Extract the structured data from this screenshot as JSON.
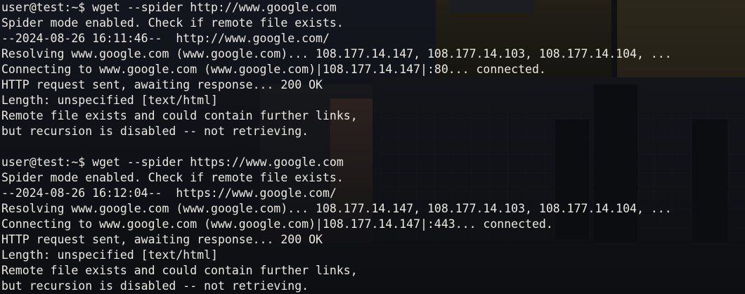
{
  "terminal": {
    "blocks": [
      {
        "prompt": "user@test:~$",
        "command": "wget --spider http://www.google.com",
        "output": [
          "Spider mode enabled. Check if remote file exists.",
          "--2024-08-26 16:11:46--  http://www.google.com/",
          "Resolving www.google.com (www.google.com)... 108.177.14.147, 108.177.14.103, 108.177.14.104, ...",
          "Connecting to www.google.com (www.google.com)|108.177.14.147|:80... connected.",
          "HTTP request sent, awaiting response... 200 OK",
          "Length: unspecified [text/html]",
          "Remote file exists and could contain further links,",
          "but recursion is disabled -- not retrieving."
        ]
      },
      {
        "prompt": "user@test:~$",
        "command": "wget --spider https://www.google.com",
        "output": [
          "Spider mode enabled. Check if remote file exists.",
          "--2024-08-26 16:12:04--  https://www.google.com/",
          "Resolving www.google.com (www.google.com)... 108.177.14.147, 108.177.14.103, 108.177.14.104, ...",
          "Connecting to www.google.com (www.google.com)|108.177.14.147|:443... connected.",
          "HTTP request sent, awaiting response... 200 OK",
          "Length: unspecified [text/html]",
          "Remote file exists and could contain further links,",
          "but recursion is disabled -- not retrieving."
        ]
      }
    ]
  }
}
